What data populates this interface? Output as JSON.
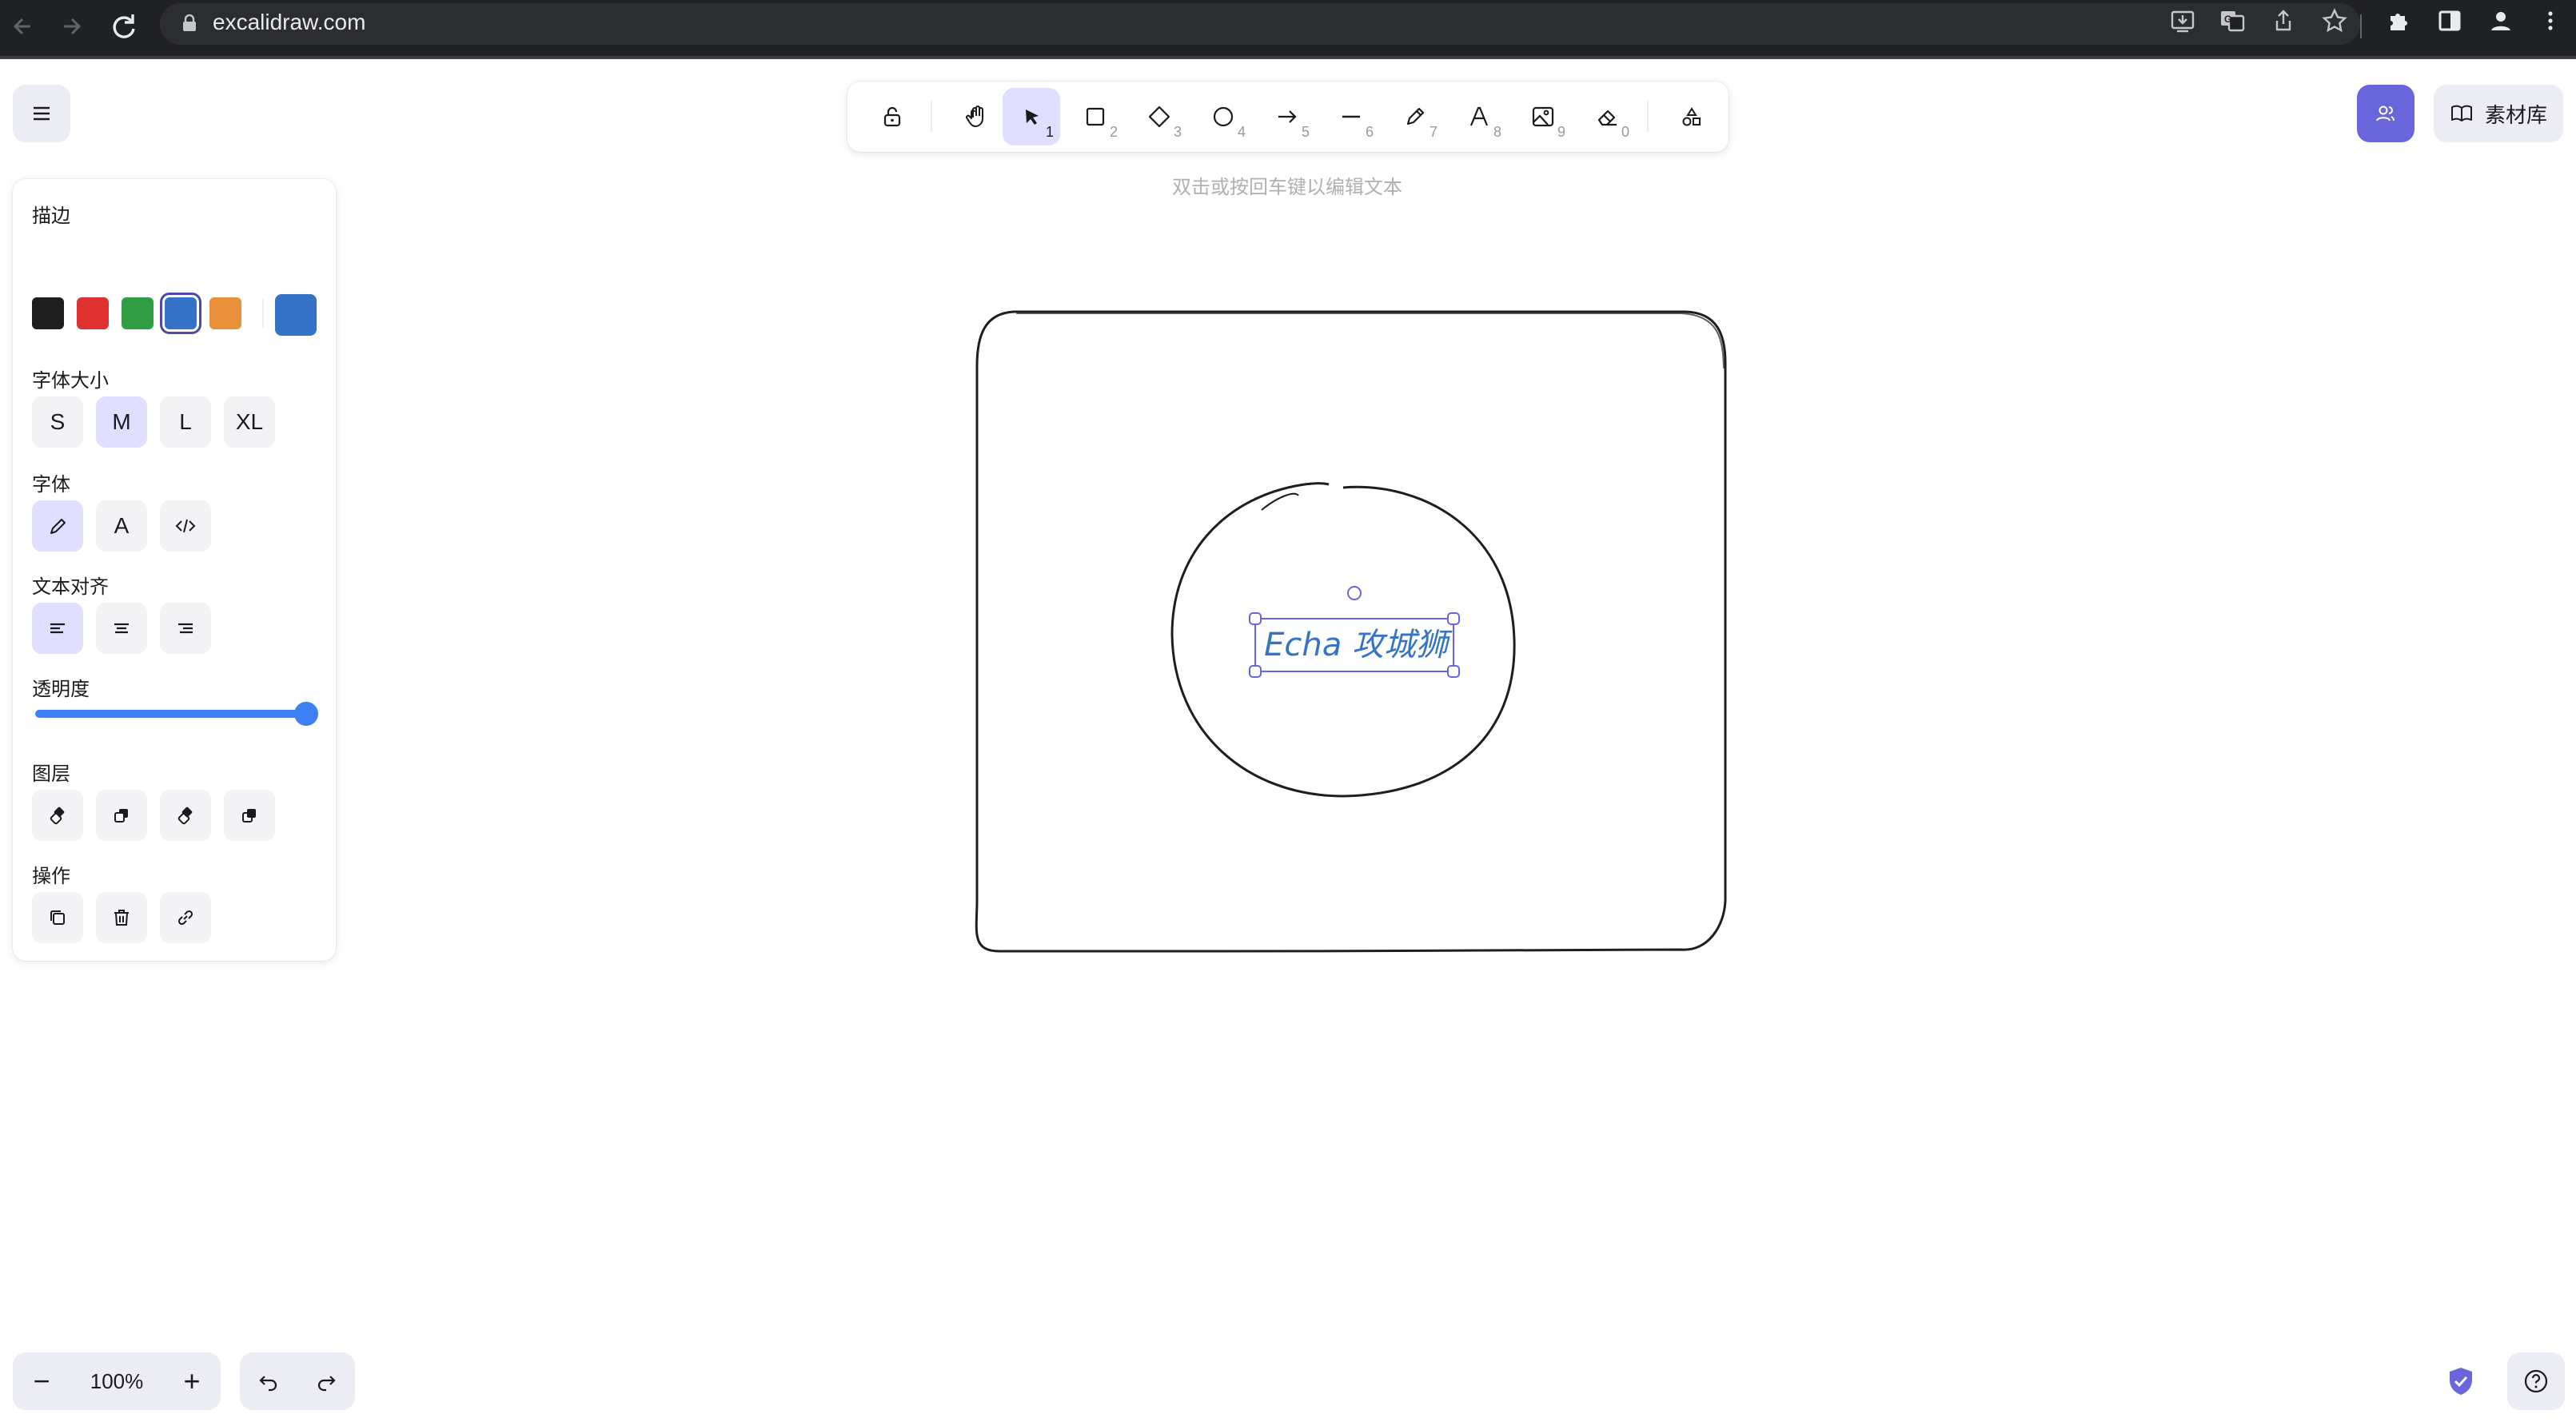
{
  "browser": {
    "url": "excalidraw.com",
    "icons": [
      "back-icon",
      "forward-icon",
      "reload-icon",
      "lock-icon",
      "install-icon",
      "translate-icon",
      "share-icon",
      "star-icon",
      "extensions-icon",
      "sidebar-icon",
      "profile-icon",
      "menu-dots-icon"
    ]
  },
  "toolbar": {
    "tools": [
      {
        "name": "lock",
        "key": ""
      },
      {
        "name": "hand",
        "key": ""
      },
      {
        "name": "selection",
        "key": "1"
      },
      {
        "name": "rectangle",
        "key": "2"
      },
      {
        "name": "diamond",
        "key": "3"
      },
      {
        "name": "ellipse",
        "key": "4"
      },
      {
        "name": "arrow",
        "key": "5"
      },
      {
        "name": "line",
        "key": "6"
      },
      {
        "name": "draw",
        "key": "7"
      },
      {
        "name": "text",
        "key": "8"
      },
      {
        "name": "image",
        "key": "9"
      },
      {
        "name": "eraser",
        "key": "0"
      },
      {
        "name": "extra-tools",
        "key": ""
      }
    ],
    "active": "selection"
  },
  "hint": "双击或按回车键以编辑文本",
  "library_label": "素材库",
  "panel": {
    "stroke_title": "描边",
    "stroke_colors": [
      "#1e1e1e",
      "#e03131",
      "#2f9e44",
      "#3473c6",
      "#e8913a"
    ],
    "stroke_selected": "#3473c6",
    "fontsize_title": "字体大小",
    "fontsizes": [
      "S",
      "M",
      "L",
      "XL"
    ],
    "fontsize_selected": "M",
    "font_title": "字体",
    "fontfamily_options": [
      "hand-drawn",
      "normal",
      "code"
    ],
    "fontfamily_normal_glyph": "A",
    "align_title": "文本对齐",
    "align_options": [
      "left",
      "center",
      "right"
    ],
    "opacity_title": "透明度",
    "opacity": 100,
    "layers_title": "图层",
    "actions_title": "操作"
  },
  "canvas": {
    "text_element": "Echa 攻城狮",
    "text_color": "#3473c6",
    "selection_color": "#6965db"
  },
  "footer": {
    "zoom": "100%",
    "zoom_out": "−",
    "zoom_in": "+"
  }
}
